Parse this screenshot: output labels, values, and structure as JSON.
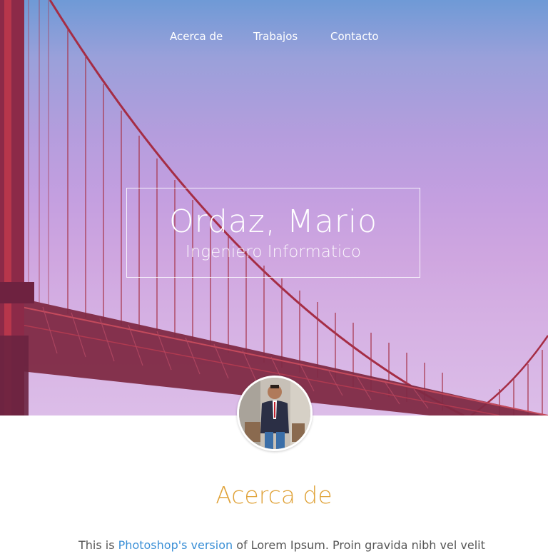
{
  "nav": {
    "items": [
      {
        "label": "Acerca de"
      },
      {
        "label": "Trabajos"
      },
      {
        "label": "Contacto"
      }
    ]
  },
  "hero": {
    "name": "Ordaz, Mario",
    "role": "Ingeniero Informatico"
  },
  "about": {
    "title": "Acerca de",
    "text_before": "This is ",
    "link_text": "Photoshop's version",
    "text_after": " of Lorem Ipsum. Proin gravida nibh vel velit"
  },
  "colors": {
    "accent": "#e0a33a",
    "link": "#3a8fd6",
    "body_text": "#555555",
    "bridge": "#9c2a3e"
  },
  "icons": {
    "avatar": "profile-photo"
  }
}
